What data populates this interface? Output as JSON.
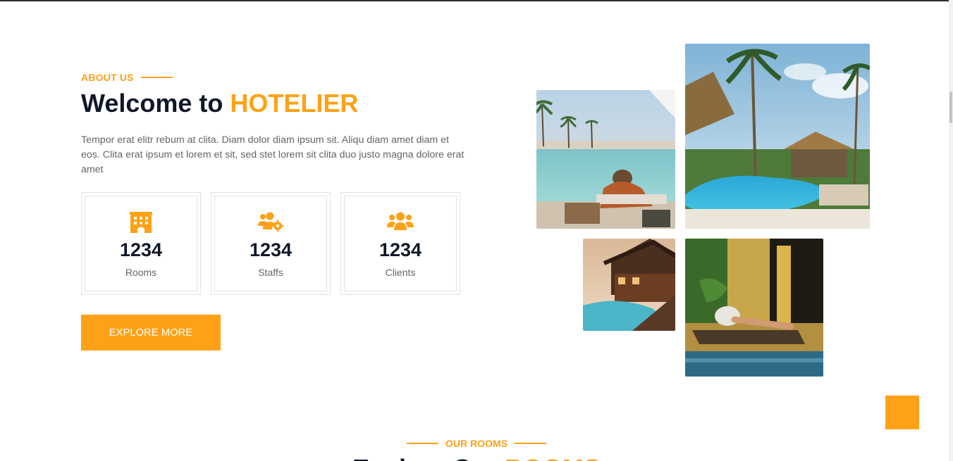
{
  "about": {
    "eyebrow": "ABOUT US",
    "title_prefix": "Welcome to ",
    "title_accent": "HOTELIER",
    "description": "Tempor erat elitr rebum at clita. Diam dolor diam ipsum sit. Aliqu diam amet diam et eos. Clita erat ipsum et lorem et sit, sed stet lorem sit clita duo justo magna dolore erat amet",
    "stats": [
      {
        "icon": "hotel-icon",
        "number": "1234",
        "label": "Rooms"
      },
      {
        "icon": "users-cog-icon",
        "number": "1234",
        "label": "Staffs"
      },
      {
        "icon": "users-icon",
        "number": "1234",
        "label": "Clients"
      }
    ],
    "button_label": "EXPLORE MORE"
  },
  "rooms": {
    "eyebrow": "OUR ROOMS",
    "title_prefix": "Explore Our ",
    "title_accent": "ROOMS"
  },
  "colors": {
    "accent": "#FEA116",
    "dark": "#0F172B",
    "body_text": "#666565"
  }
}
